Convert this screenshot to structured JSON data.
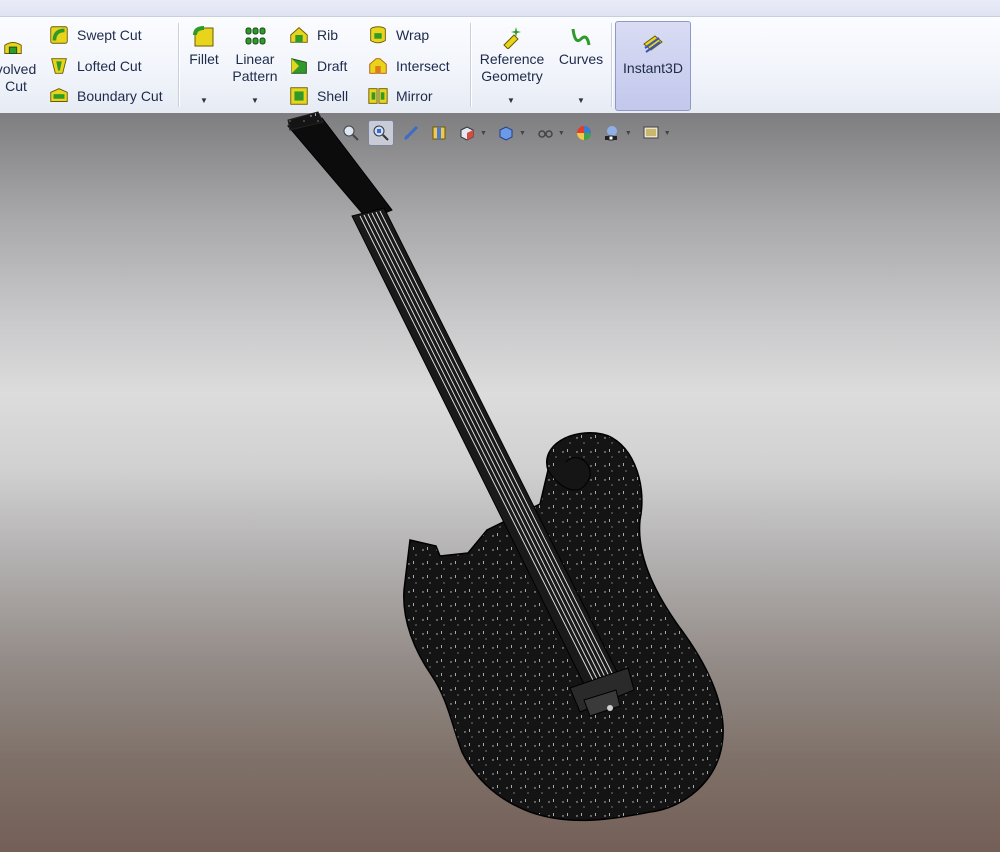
{
  "ribbon": {
    "revolved_cut": {
      "line1": "volved",
      "line2": "Cut"
    },
    "swept_cut": "Swept Cut",
    "lofted_cut": "Lofted Cut",
    "boundary_cut": "Boundary Cut",
    "fillet": "Fillet",
    "linear_pattern": {
      "line1": "Linear",
      "line2": "Pattern"
    },
    "rib": "Rib",
    "draft": "Draft",
    "shell": "Shell",
    "wrap": "Wrap",
    "intersect": "Intersect",
    "mirror": "Mirror",
    "reference_geometry": {
      "line1": "Reference",
      "line2": "Geometry"
    },
    "curves": "Curves",
    "instant3d": "Instant3D"
  },
  "heads_up_toolbar": {
    "icons": [
      "zoom-to-fit-icon",
      "zoom-to-area-icon",
      "previous-view-icon",
      "section-view-icon",
      "view-orientation-icon",
      "display-style-icon",
      "hide-show-items-icon",
      "edit-appearance-icon",
      "apply-scene-icon",
      "view-settings-icon"
    ]
  },
  "colors": {
    "ribbon_text": "#1d2a4a",
    "feature_icon_green": "#2f9a2a",
    "feature_icon_yellow": "#e9d41c",
    "active_button": "#c3c8ec",
    "model_body": "#121212"
  }
}
